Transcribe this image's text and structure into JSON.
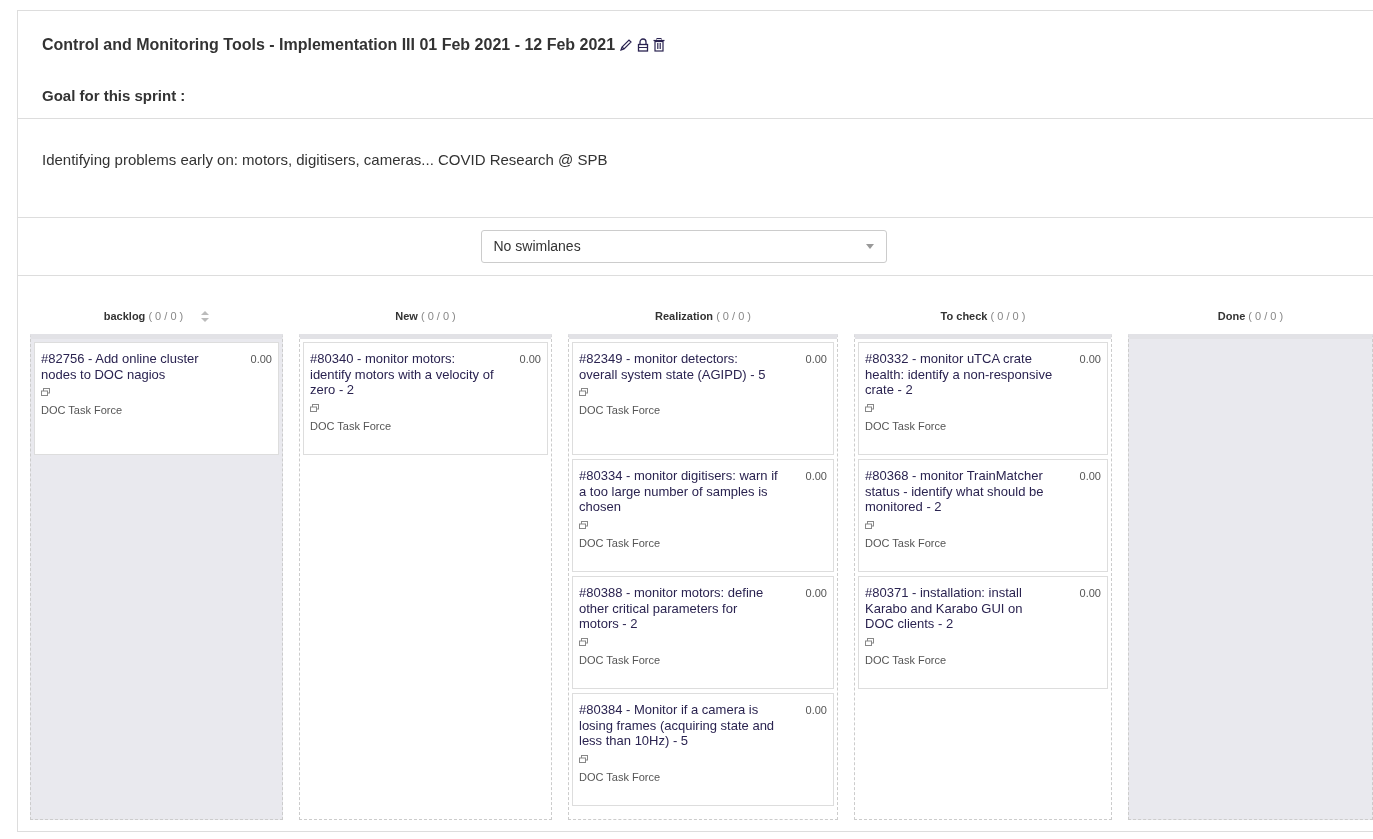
{
  "sprint": {
    "title": "Control and Monitoring Tools - Implementation III 01 Feb 2021 - 12 Feb 2021",
    "goal_label": "Goal for this sprint :",
    "goal": "Identifying problems early on: motors, digitisers, cameras... COVID Research @ SPB"
  },
  "swimlanes": {
    "value": "No swimlanes"
  },
  "columns": [
    {
      "name": "backlog",
      "count": "( 0 / 0 )",
      "sortable": true,
      "shaded": true,
      "cards": [
        {
          "title": "#82756 - Add online cluster nodes to DOC nagios",
          "points": "0.00",
          "team": "DOC Task Force"
        }
      ]
    },
    {
      "name": "New",
      "count": "( 0 / 0 )",
      "sortable": false,
      "shaded": false,
      "cards": [
        {
          "title": "#80340 - monitor motors: identify motors with a velocity of zero - 2",
          "points": "0.00",
          "team": "DOC Task Force"
        }
      ]
    },
    {
      "name": "Realization",
      "count": "( 0 / 0 )",
      "sortable": false,
      "shaded": false,
      "cards": [
        {
          "title": "#82349 - monitor detectors: overall system state (AGIPD) - 5",
          "points": "0.00",
          "team": "DOC Task Force"
        },
        {
          "title": "#80334 - monitor digitisers: warn if a too large number of samples is chosen",
          "points": "0.00",
          "team": "DOC Task Force"
        },
        {
          "title": "#80388 - monitor motors: define other critical parameters for motors - 2",
          "points": "0.00",
          "team": "DOC Task Force"
        },
        {
          "title": "#80384 - Monitor if a camera is losing frames (acquiring state and less than 10Hz) - 5",
          "points": "0.00",
          "team": "DOC Task Force"
        }
      ]
    },
    {
      "name": "To check",
      "count": "( 0 / 0 )",
      "sortable": false,
      "shaded": false,
      "cards": [
        {
          "title": "#80332 - monitor uTCA crate health: identify a non-responsive crate - 2",
          "points": "0.00",
          "team": "DOC Task Force"
        },
        {
          "title": "#80368 - monitor TrainMatcher status - identify what should be monitored - 2",
          "points": "0.00",
          "team": "DOC Task Force"
        },
        {
          "title": "#80371 - installation: install Karabo and Karabo GUI on DOC clients - 2",
          "points": "0.00",
          "team": "DOC Task Force"
        }
      ]
    },
    {
      "name": "Done",
      "count": "( 0 / 0 )",
      "sortable": false,
      "shaded": true
    }
  ]
}
